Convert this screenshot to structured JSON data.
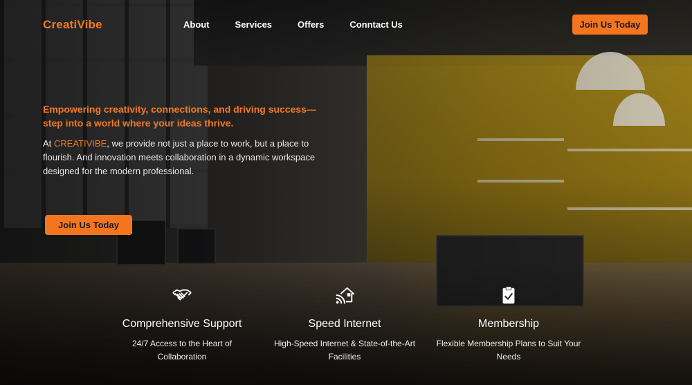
{
  "nav": {
    "logo": "CreatiVibe",
    "links": [
      "About",
      "Services",
      "Offers",
      "Conntact Us"
    ],
    "cta_label": "Join Us Today"
  },
  "hero": {
    "headline": "Empowering creativity, connections, and driving success—step into a world where your ideas thrive.",
    "body_prefix": "At ",
    "body_brand": "CREATIVIBE",
    "body_suffix": ", we provide not just a place to work, but a place to flourish. And innovation meets collaboration in a dynamic workspace designed for the modern professional.",
    "cta_label": "Join Us Today"
  },
  "features": [
    {
      "icon": "handshake-icon",
      "title": "Comprehensive Support",
      "description": "24/7 Access to the Heart of Collaboration"
    },
    {
      "icon": "wifi-house-icon",
      "title": "Speed Internet",
      "description": "High-Speed Internet & State-of-the-Art Facilities"
    },
    {
      "icon": "clipboard-check-icon",
      "title": "Membership",
      "description": "Flexible Membership Plans to Suit Your Needs"
    }
  ],
  "colors": {
    "accent": "#f3761f",
    "text": "#ffffff"
  }
}
